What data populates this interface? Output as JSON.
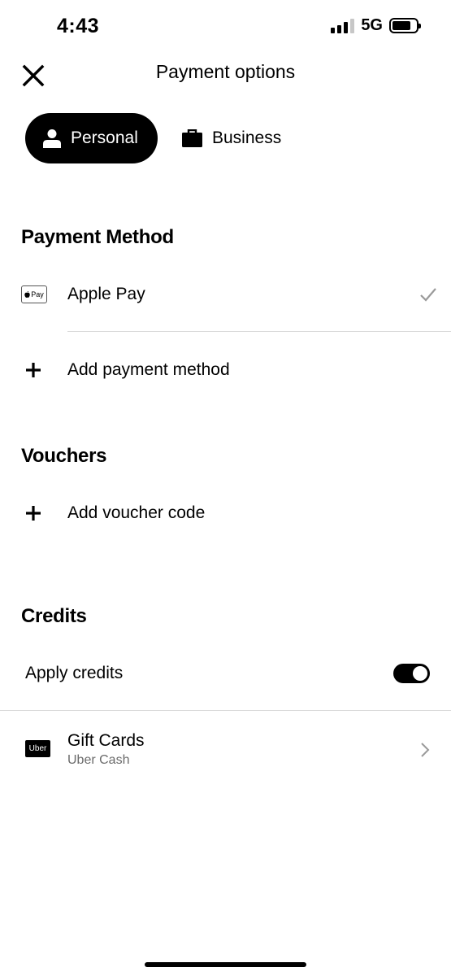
{
  "status_bar": {
    "time": "4:43",
    "network": "5G"
  },
  "header": {
    "title": "Payment options"
  },
  "profiles": {
    "personal": "Personal",
    "business": "Business",
    "selected": "Personal"
  },
  "payment_method": {
    "title": "Payment Method",
    "apple_pay": {
      "icon_text": "Pay",
      "label": "Apple Pay",
      "selected": true
    },
    "add_label": "Add payment method"
  },
  "vouchers": {
    "title": "Vouchers",
    "add_label": "Add voucher code"
  },
  "credits": {
    "title": "Credits",
    "apply_label": "Apply credits",
    "apply_enabled": true,
    "gift_cards": {
      "logo_text": "Uber",
      "title": "Gift Cards",
      "subtitle": "Uber Cash"
    }
  },
  "colors": {
    "primary": "#000000",
    "divider": "#d8d8d8",
    "muted": "#6b6b6b"
  }
}
